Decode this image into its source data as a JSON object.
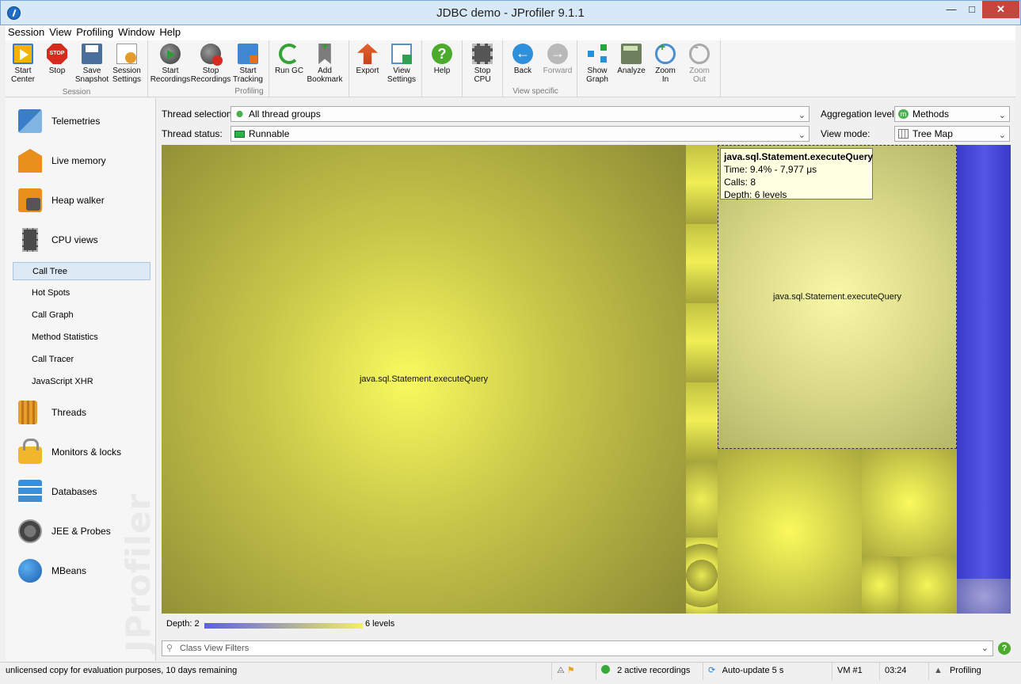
{
  "window": {
    "title": "JDBC demo - JProfiler 9.1.1",
    "min": "—",
    "max": "□",
    "close": "✕"
  },
  "menu": [
    "Session",
    "View",
    "Profiling",
    "Window",
    "Help"
  ],
  "toolbar": {
    "groups": [
      "Session",
      "Profiling",
      "View specific"
    ],
    "buttons": [
      {
        "label": "Start\nCenter",
        "icon": "start-center-icon"
      },
      {
        "label": "Stop",
        "icon": "stop-icon",
        "badge": "STOP"
      },
      {
        "label": "Save\nSnapshot",
        "icon": "save-snapshot-icon"
      },
      {
        "label": "Session\nSettings",
        "icon": "session-settings-icon"
      },
      {
        "label": "Start\nRecordings",
        "icon": "start-recordings-icon"
      },
      {
        "label": "Stop\nRecordings",
        "icon": "stop-recordings-icon"
      },
      {
        "label": "Start\nTracking",
        "icon": "start-tracking-icon"
      },
      {
        "label": "Run GC",
        "icon": "run-gc-icon"
      },
      {
        "label": "Add\nBookmark",
        "icon": "add-bookmark-icon"
      },
      {
        "label": "Export",
        "icon": "export-icon"
      },
      {
        "label": "View\nSettings",
        "icon": "view-settings-icon"
      },
      {
        "label": "Help",
        "icon": "help-icon",
        "glyph": "?"
      },
      {
        "label": "Stop\nCPU",
        "icon": "stop-cpu-icon"
      },
      {
        "label": "Back",
        "icon": "back-icon",
        "glyph": "←"
      },
      {
        "label": "Forward",
        "icon": "forward-icon",
        "glyph": "→",
        "disabled": true
      },
      {
        "label": "Show\nGraph",
        "icon": "show-graph-icon"
      },
      {
        "label": "Analyze",
        "icon": "analyze-icon"
      },
      {
        "label": "Zoom\nIn",
        "icon": "zoom-in-icon"
      },
      {
        "label": "Zoom\nOut",
        "icon": "zoom-out-icon",
        "disabled": true
      }
    ]
  },
  "sidebar": {
    "items": [
      {
        "label": "Telemetries",
        "icon": "telemetries-icon"
      },
      {
        "label": "Live memory",
        "icon": "live-memory-icon"
      },
      {
        "label": "Heap walker",
        "icon": "heap-walker-icon"
      },
      {
        "label": "CPU views",
        "icon": "cpu-views-icon"
      }
    ],
    "sub_items": [
      "Call Tree",
      "Hot Spots",
      "Call Graph",
      "Method Statistics",
      "Call Tracer",
      "JavaScript XHR"
    ],
    "active_sub_item": "Call Tree",
    "items2": [
      {
        "label": "Threads",
        "icon": "threads-icon"
      },
      {
        "label": "Monitors & locks",
        "icon": "monitors-locks-icon"
      },
      {
        "label": "Databases",
        "icon": "databases-icon"
      },
      {
        "label": "JEE & Probes",
        "icon": "jee-probes-icon"
      },
      {
        "label": "MBeans",
        "icon": "mbeans-icon"
      }
    ],
    "watermark": "JProfiler"
  },
  "filters": {
    "thread_selection_label": "Thread selection:",
    "thread_selection_value": "All thread groups",
    "thread_status_label": "Thread status:",
    "thread_status_value": "Runnable",
    "aggregation_label": "Aggregation level:",
    "aggregation_value": "Methods",
    "aggregation_badge": "m",
    "view_mode_label": "View mode:",
    "view_mode_value": "Tree Map"
  },
  "treemap": {
    "main_label": "java.sql.Statement.executeQuery",
    "hover_label": "java.sql.Statement.executeQuery",
    "tooltip": {
      "title": "java.sql.Statement.executeQuery",
      "time": "Time: 9.4% - 7,977 μs",
      "calls": "Calls: 8",
      "depth": "Depth: 6 levels"
    }
  },
  "depth": {
    "label": "Depth:",
    "min": "2",
    "max": "6 levels"
  },
  "class_filter": {
    "placeholder": "Class View Filters"
  },
  "statusbar": {
    "license": "unlicensed copy for evaluation purposes, 10 days remaining",
    "recordings": "2 active recordings",
    "autoupdate": "Auto-update 5 s",
    "vm": "VM #1",
    "time": "03:24",
    "mode": "Profiling"
  },
  "colors": {
    "treemap_yellow": "#f5f554",
    "treemap_blue": "#4444d8",
    "selection_bg": "#dde9f5"
  }
}
